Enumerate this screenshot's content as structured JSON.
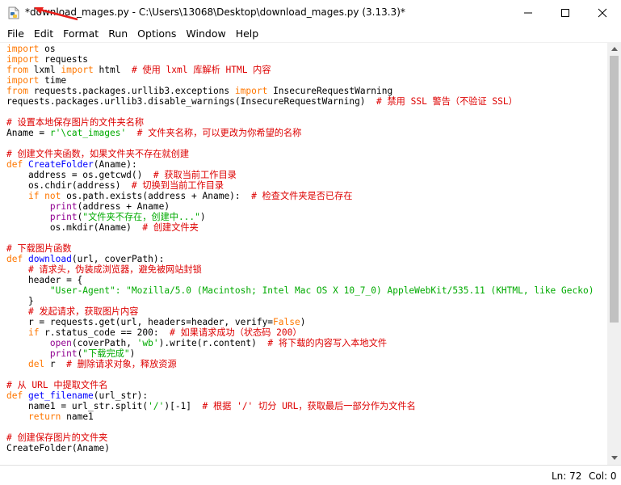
{
  "window": {
    "title": "*download_mages.py - C:\\Users\\13068\\Desktop\\download_mages.py (3.13.3)*",
    "icon": "python-file-icon"
  },
  "menu": [
    "File",
    "Edit",
    "Format",
    "Run",
    "Options",
    "Window",
    "Help"
  ],
  "code_lines": [
    [
      [
        "k",
        "import"
      ],
      [
        "n",
        " os"
      ]
    ],
    [
      [
        "k",
        "import"
      ],
      [
        "n",
        " requests"
      ]
    ],
    [
      [
        "k",
        "from"
      ],
      [
        "n",
        " lxml "
      ],
      [
        "k",
        "import"
      ],
      [
        "n",
        " html  "
      ],
      [
        "c",
        "# 使用 lxml 库解析 HTML 内容"
      ]
    ],
    [
      [
        "k",
        "import"
      ],
      [
        "n",
        " time"
      ]
    ],
    [
      [
        "k",
        "from"
      ],
      [
        "n",
        " requests.packages.urllib3.exceptions "
      ],
      [
        "k",
        "import"
      ],
      [
        "n",
        " InsecureRequestWarning"
      ]
    ],
    [
      [
        "n",
        "requests.packages.urllib3.disable_warnings(InsecureRequestWarning)  "
      ],
      [
        "c",
        "# 禁用 SSL 警告（不验证 SSL）"
      ]
    ],
    [],
    [
      [
        "c",
        "# 设置本地保存图片的文件夹名称"
      ]
    ],
    [
      [
        "n",
        "Aname = "
      ],
      [
        "s",
        "r'\\cat_images'"
      ],
      [
        "n",
        "  "
      ],
      [
        "c",
        "# 文件夹名称，可以更改为你希望的名称"
      ]
    ],
    [],
    [
      [
        "c",
        "# 创建文件夹函数，如果文件夹不存在就创建"
      ]
    ],
    [
      [
        "k",
        "def"
      ],
      [
        "n",
        " "
      ],
      [
        "d",
        "CreateFolder"
      ],
      [
        "n",
        "(Aname):"
      ]
    ],
    [
      [
        "n",
        "    address = os.getcwd()  "
      ],
      [
        "c",
        "# 获取当前工作目录"
      ]
    ],
    [
      [
        "n",
        "    os.chdir(address)  "
      ],
      [
        "c",
        "# 切换到当前工作目录"
      ]
    ],
    [
      [
        "n",
        "    "
      ],
      [
        "k",
        "if not"
      ],
      [
        "n",
        " os.path.exists(address + Aname):  "
      ],
      [
        "c",
        "# 检查文件夹是否已存在"
      ]
    ],
    [
      [
        "n",
        "        "
      ],
      [
        "b",
        "print"
      ],
      [
        "n",
        "(address + Aname)"
      ]
    ],
    [
      [
        "n",
        "        "
      ],
      [
        "b",
        "print"
      ],
      [
        "n",
        "("
      ],
      [
        "s",
        "\"文件夹不存在，创建中...\""
      ],
      [
        "n",
        ")"
      ]
    ],
    [
      [
        "n",
        "        os.mkdir(Aname)  "
      ],
      [
        "c",
        "# 创建文件夹"
      ]
    ],
    [],
    [
      [
        "c",
        "# 下载图片函数"
      ]
    ],
    [
      [
        "k",
        "def"
      ],
      [
        "n",
        " "
      ],
      [
        "d",
        "download"
      ],
      [
        "n",
        "(url, coverPath):"
      ]
    ],
    [
      [
        "n",
        "    "
      ],
      [
        "c",
        "# 请求头，伪装成浏览器，避免被网站封锁"
      ]
    ],
    [
      [
        "n",
        "    header = {"
      ]
    ],
    [
      [
        "n",
        "        "
      ],
      [
        "s",
        "\"User-Agent\": \"Mozilla/5.0 (Macintosh; Intel Mac OS X 10_7_0) AppleWebKit/535.11 (KHTML, like Gecko)"
      ]
    ],
    [
      [
        "n",
        "    }"
      ]
    ],
    [
      [
        "n",
        "    "
      ],
      [
        "c",
        "# 发起请求，获取图片内容"
      ]
    ],
    [
      [
        "n",
        "    r = requests.get(url, headers=header, verify="
      ],
      [
        "k",
        "False"
      ],
      [
        "n",
        ")"
      ]
    ],
    [
      [
        "n",
        "    "
      ],
      [
        "k",
        "if"
      ],
      [
        "n",
        " r.status_code == 200:  "
      ],
      [
        "c",
        "# 如果请求成功（状态码 200）"
      ]
    ],
    [
      [
        "n",
        "        "
      ],
      [
        "b",
        "open"
      ],
      [
        "n",
        "(coverPath, "
      ],
      [
        "s",
        "'wb'"
      ],
      [
        "n",
        ").write(r.content)  "
      ],
      [
        "c",
        "# 将下载的内容写入本地文件"
      ]
    ],
    [
      [
        "n",
        "        "
      ],
      [
        "b",
        "print"
      ],
      [
        "n",
        "("
      ],
      [
        "s",
        "\"下载完成\""
      ],
      [
        "n",
        ")"
      ]
    ],
    [
      [
        "n",
        "    "
      ],
      [
        "k",
        "del"
      ],
      [
        "n",
        " r  "
      ],
      [
        "c",
        "# 删除请求对象，释放资源"
      ]
    ],
    [],
    [
      [
        "c",
        "# 从 URL 中提取文件名"
      ]
    ],
    [
      [
        "k",
        "def"
      ],
      [
        "n",
        " "
      ],
      [
        "d",
        "get_filename"
      ],
      [
        "n",
        "(url_str):"
      ]
    ],
    [
      [
        "n",
        "    name1 = url_str.split("
      ],
      [
        "s",
        "'/'"
      ],
      [
        "n",
        ")[-1]  "
      ],
      [
        "c",
        "# 根据 '/' 切分 URL，获取最后一部分作为文件名"
      ]
    ],
    [
      [
        "n",
        "    "
      ],
      [
        "k",
        "return"
      ],
      [
        "n",
        " name1"
      ]
    ],
    [],
    [
      [
        "c",
        "# 创建保存图片的文件夹"
      ]
    ],
    [
      [
        "n",
        "CreateFolder(Aname)"
      ]
    ]
  ],
  "status": {
    "line": "Ln: 72",
    "col": "Col: 0"
  }
}
